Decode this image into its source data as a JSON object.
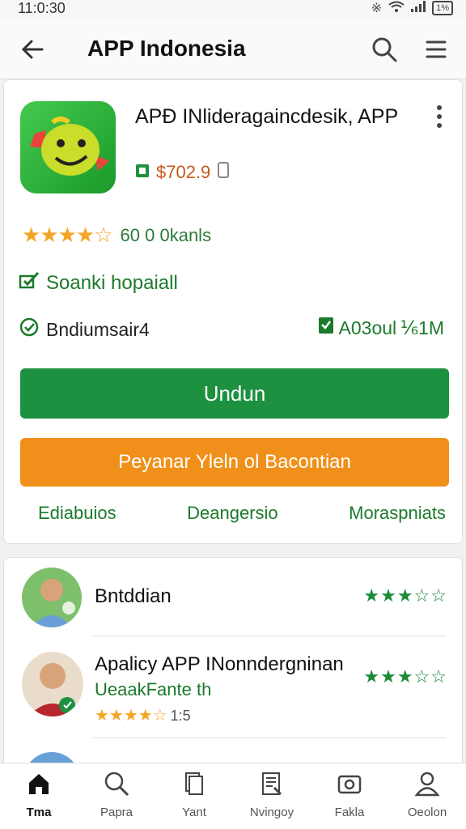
{
  "status_bar": {
    "time": "11:0:30",
    "battery": "1%"
  },
  "app_bar": {
    "title": "APP Indonesia"
  },
  "app": {
    "name": "APÐ INlideragaincdesik, APP",
    "price": "$702.9",
    "rating_text": "60 0 0kanls",
    "rating_value": 4.5,
    "verified_label": "Soanki hopaiall",
    "meta_left": "Bndiumsair4",
    "meta_right": "A03oul ⅙1M",
    "primary_button": "Undun",
    "secondary_button": "Peyanar Yleln ol Bacontian",
    "links": [
      "Ediabuios",
      "Deangersio",
      "Moraspniats"
    ]
  },
  "reviews": [
    {
      "name": "Bntddian",
      "stars": 3.5
    },
    {
      "name": "Apalicy APP INonndergninan",
      "subtitle": "UeaakFante th",
      "rating_value": "1:5",
      "user_stars": 4.5,
      "stars": 3.5
    }
  ],
  "colors": {
    "accent_green": "#1e9140",
    "accent_orange": "#f0901a",
    "star": "#f5a524"
  },
  "bottom_nav": [
    {
      "label": "Tma",
      "icon": "home-icon"
    },
    {
      "label": "Papra",
      "icon": "search-icon"
    },
    {
      "label": "Yant",
      "icon": "document-icon"
    },
    {
      "label": "Nvingoy",
      "icon": "chart-icon"
    },
    {
      "label": "Fakla",
      "icon": "camera-icon"
    },
    {
      "label": "Oeolon",
      "icon": "person-icon"
    }
  ]
}
